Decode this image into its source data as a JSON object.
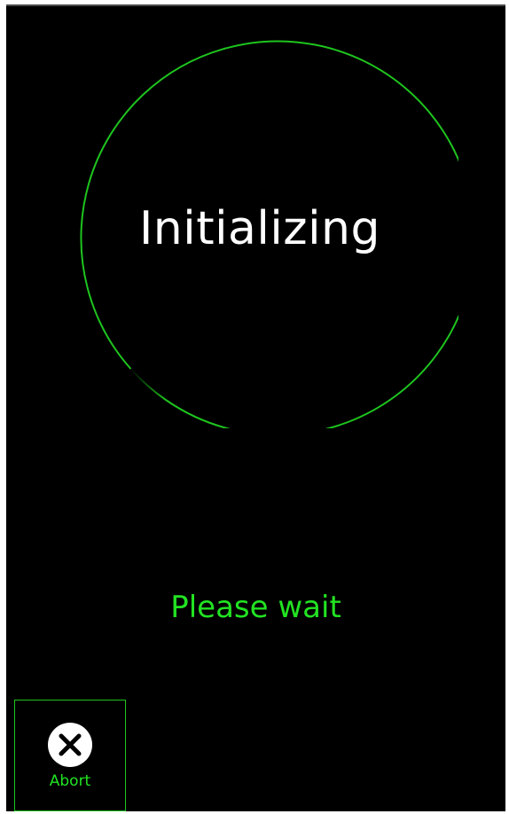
{
  "status": {
    "title": "Initializing",
    "message": "Please wait",
    "progress_color": "#1ec41e",
    "message_color": "#22e322"
  },
  "controls": {
    "abort_label": "Abort",
    "abort_icon": "close-icon"
  }
}
